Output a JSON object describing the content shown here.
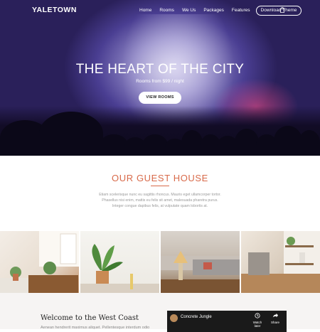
{
  "nav": {
    "logo": "YALETOWN",
    "items": [
      "Home",
      "Rooms",
      "We Us",
      "Packages",
      "Features"
    ],
    "download_label": "Download Theme",
    "cart_icon": "bag-icon"
  },
  "hero": {
    "title": "THE HEART OF THE CITY",
    "subtitle": "Rooms from $99 / night",
    "button_label": "VIEW ROOMS"
  },
  "guest": {
    "title": "OUR GUEST HOUSE",
    "lines": [
      "Etiam scelerisque nunc eu sagittis rhoncus. Mauris eget ullamcorper tortor.",
      "Phasellus nisi enim, mattis eu felis sit amet, malesuada pharetra purus.",
      "Integer congue dapibus felis, at vulputate quam lobortis at."
    ],
    "accent_color": "#d86a4a"
  },
  "gallery": {
    "tiles": [
      "bright-living-room-photo",
      "potted-plant-photo",
      "lounge-sofa-photo",
      "kitchen-shelves-photo"
    ]
  },
  "welcome": {
    "title": "Welcome to the West Coast",
    "text": "Aenean hendrerit maximus aliquet. Pellentesque interdum odio"
  },
  "video": {
    "title": "Concrete Jungle",
    "watch_label": "Watch later",
    "share_label": "Share"
  }
}
